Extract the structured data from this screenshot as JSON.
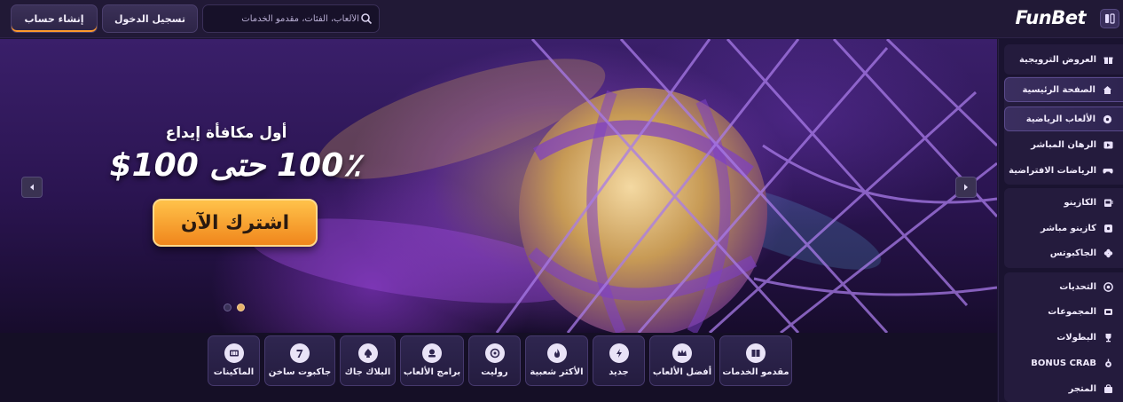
{
  "header": {
    "register_label": "إنشاء حساب",
    "login_label": "تسجيل الدخول",
    "search_placeholder": "الألعاب، الفئات، مقدمو الخدمات",
    "logo": "FunBet"
  },
  "sidebar": {
    "groups": [
      {
        "items": [
          {
            "label": "العروض الترويجية",
            "icon": "gift-icon"
          }
        ]
      },
      {
        "items": [
          {
            "label": "الصفحة الرئيسية",
            "icon": "home-icon",
            "active": true
          },
          {
            "label": "الألعاب الرياضية",
            "icon": "soccer-ball-icon",
            "active": true
          },
          {
            "label": "الرهان المباشر",
            "icon": "live-play-icon"
          },
          {
            "label": "الرياضات الافتراضية",
            "icon": "gamepad-icon"
          }
        ]
      },
      {
        "items": [
          {
            "label": "الكازينو",
            "icon": "slot-machine-icon"
          },
          {
            "label": "كازينو مباشر",
            "icon": "live-casino-icon"
          },
          {
            "label": "الجاكبوتس",
            "icon": "clover-icon"
          }
        ]
      },
      {
        "items": [
          {
            "label": "التحديات",
            "icon": "target-icon"
          },
          {
            "label": "المجموعات",
            "icon": "collection-icon"
          },
          {
            "label": "البطولات",
            "icon": "trophy-icon"
          },
          {
            "label": "BONUS CRAB",
            "icon": "crab-icon"
          },
          {
            "label": "المتجر",
            "icon": "shop-icon"
          }
        ]
      }
    ]
  },
  "banner": {
    "subtitle": "أول مكافأة إيداع",
    "headline": "100٪ حتى 100$",
    "cta_label": "اشترك الآن",
    "slides_total": 2,
    "slide_active": 2
  },
  "categories": [
    {
      "label": "مقدمو الخدمات",
      "icon": "book-icon"
    },
    {
      "label": "أفضل الألعاب",
      "icon": "crown-icon"
    },
    {
      "label": "جديد",
      "icon": "lightning-icon"
    },
    {
      "label": "الأكثر شعبية",
      "icon": "flame-icon"
    },
    {
      "label": "روليت",
      "icon": "roulette-icon"
    },
    {
      "label": "برامج الألعاب",
      "icon": "game-show-icon"
    },
    {
      "label": "البلاك جاك",
      "icon": "spade-icon"
    },
    {
      "label": "جاكبوت ساخن",
      "icon": "seven-icon"
    },
    {
      "label": "الماكينات",
      "icon": "slot-icon"
    }
  ],
  "colors": {
    "background": "#1b1430",
    "accent": "#f0861c",
    "sidebar_active_border": "#5a4a8c"
  }
}
